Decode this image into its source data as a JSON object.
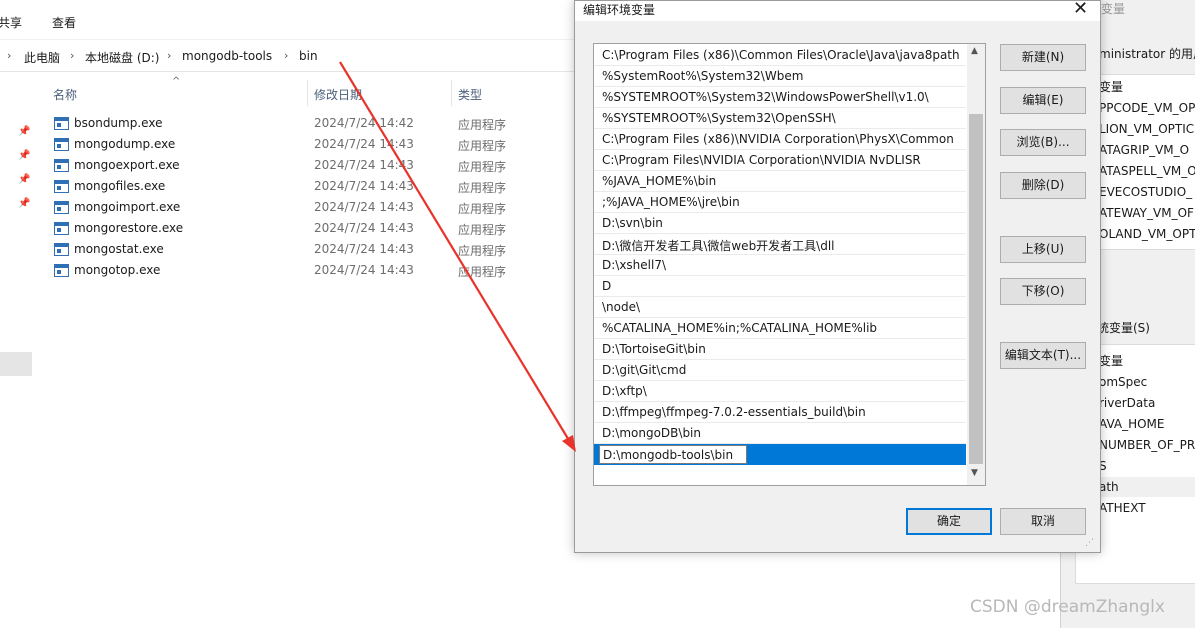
{
  "explorer": {
    "ribbon_tabs": [
      "共享",
      "查看"
    ],
    "breadcrumb": [
      "此电脑",
      "本地磁盘 (D:)",
      "mongodb-tools",
      "bin"
    ],
    "columns": {
      "name": "名称",
      "date": "修改日期",
      "type": "类型"
    },
    "files": [
      {
        "name": "bsondump.exe",
        "date": "2024/7/24 14:42",
        "type": "应用程序"
      },
      {
        "name": "mongodump.exe",
        "date": "2024/7/24 14:43",
        "type": "应用程序"
      },
      {
        "name": "mongoexport.exe",
        "date": "2024/7/24 14:43",
        "type": "应用程序"
      },
      {
        "name": "mongofiles.exe",
        "date": "2024/7/24 14:43",
        "type": "应用程序"
      },
      {
        "name": "mongoimport.exe",
        "date": "2024/7/24 14:43",
        "type": "应用程序"
      },
      {
        "name": "mongorestore.exe",
        "date": "2024/7/24 14:43",
        "type": "应用程序"
      },
      {
        "name": "mongostat.exe",
        "date": "2024/7/24 14:43",
        "type": "应用程序"
      },
      {
        "name": "mongotop.exe",
        "date": "2024/7/24 14:43",
        "type": "应用程序"
      }
    ]
  },
  "sysprops": {
    "title_fragment": "变量",
    "user_label": "ministrator 的用户",
    "user_var_header": "变量",
    "user_vars": [
      "PPCODE_VM_OP",
      "LION_VM_OPTIC",
      "ATAGRIP_VM_O",
      "ATASPELL_VM_O",
      "EVECOSTUDIO_",
      "ATEWAY_VM_OF",
      "OLAND_VM_OPT"
    ],
    "sys_label": "统变量(S)",
    "sys_var_header": "变量",
    "sys_vars": [
      "omSpec",
      "riverData",
      "AVA_HOME",
      "NUMBER_OF_PRO",
      "S",
      "ath",
      "ATHEXT"
    ],
    "sys_selected_index": 5
  },
  "dialog": {
    "title": "编辑环境变量",
    "close_glyph": "✕",
    "paths": [
      "C:\\Program Files (x86)\\Common Files\\Oracle\\Java\\java8path",
      "%SystemRoot%\\System32\\Wbem",
      "%SYSTEMROOT%\\System32\\WindowsPowerShell\\v1.0\\",
      "%SYSTEMROOT%\\System32\\OpenSSH\\",
      "C:\\Program Files (x86)\\NVIDIA Corporation\\PhysX\\Common",
      "C:\\Program Files\\NVIDIA Corporation\\NVIDIA NvDLISR",
      "%JAVA_HOME%\\bin",
      ";%JAVA_HOME%\\jre\\bin",
      "D:\\svn\\bin",
      "D:\\微信开发者工具\\微信web开发者工具\\dll",
      "D:\\xshell7\\",
      "D",
      "\\node\\",
      "%CATALINA_HOME%in;%CATALINA_HOME%lib",
      "D:\\TortoiseGit\\bin",
      "D:\\git\\Git\\cmd",
      "D:\\xftp\\",
      "D:\\ffmpeg\\ffmpeg-7.0.2-essentials_build\\bin",
      "D:\\mongoDB\\bin",
      "D:\\mongodb-tools\\bin"
    ],
    "editing_index": 19,
    "buttons": {
      "new": "新建(N)",
      "edit": "编辑(E)",
      "browse": "浏览(B)...",
      "delete": "删除(D)",
      "move_up": "上移(U)",
      "move_down": "下移(O)",
      "edit_text": "编辑文本(T)...",
      "ok": "确定",
      "cancel": "取消"
    }
  },
  "watermark": "CSDN @dreamZhanglx",
  "colors": {
    "selection": "#0078d7",
    "annotation_arrow": "#e8332a"
  }
}
